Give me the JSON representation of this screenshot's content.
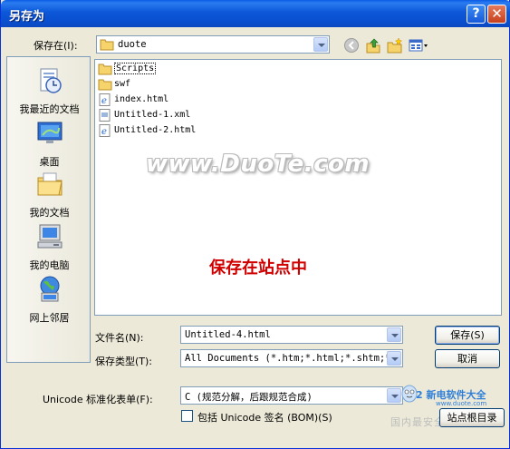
{
  "window": {
    "title": "另存为"
  },
  "titlebar": {
    "help_label": "?",
    "close_label": "✕"
  },
  "save_in": {
    "label": "保存在(I):",
    "value": "duote"
  },
  "places": [
    {
      "label": "我最近的文档",
      "icon": "recent-documents-icon"
    },
    {
      "label": "桌面",
      "icon": "desktop-icon"
    },
    {
      "label": "我的文档",
      "icon": "my-documents-icon"
    },
    {
      "label": "我的电脑",
      "icon": "my-computer-icon"
    },
    {
      "label": "网上邻居",
      "icon": "network-places-icon"
    }
  ],
  "files": [
    {
      "name": "Scripts",
      "icon": "folder-icon",
      "selected": true
    },
    {
      "name": "swf",
      "icon": "folder-icon"
    },
    {
      "name": "index.html",
      "icon": "ie-file-icon"
    },
    {
      "name": "Untitled-1.xml",
      "icon": "xml-file-icon"
    },
    {
      "name": "Untitled-2.html",
      "icon": "ie-file-icon"
    }
  ],
  "watermark": "www.DuoTe.com",
  "annotation": "保存在站点中",
  "filename": {
    "label": "文件名(N):",
    "value": "Untitled-4.html"
  },
  "filetype": {
    "label": "保存类型(T):",
    "value": "All Documents (*.htm;*.html;*.shtm;*."
  },
  "buttons": {
    "save": "保存(S)",
    "cancel": "取消",
    "site_root": "站点根目录"
  },
  "unicode": {
    "label": "Unicode 标准化表单(F):",
    "value": "C (规范分解，后跟规范合成)"
  },
  "bom": {
    "label": "包括 Unicode 签名 (BOM)(S)",
    "checked": false
  },
  "brand": {
    "line1": "2 新电软件大全",
    "url": "www.duote.com",
    "line2": "国内最安全的软件站"
  },
  "colors": {
    "titlebar": "#0a4fcf",
    "annotation": "#d00000",
    "link_border": "#7f9db9"
  }
}
